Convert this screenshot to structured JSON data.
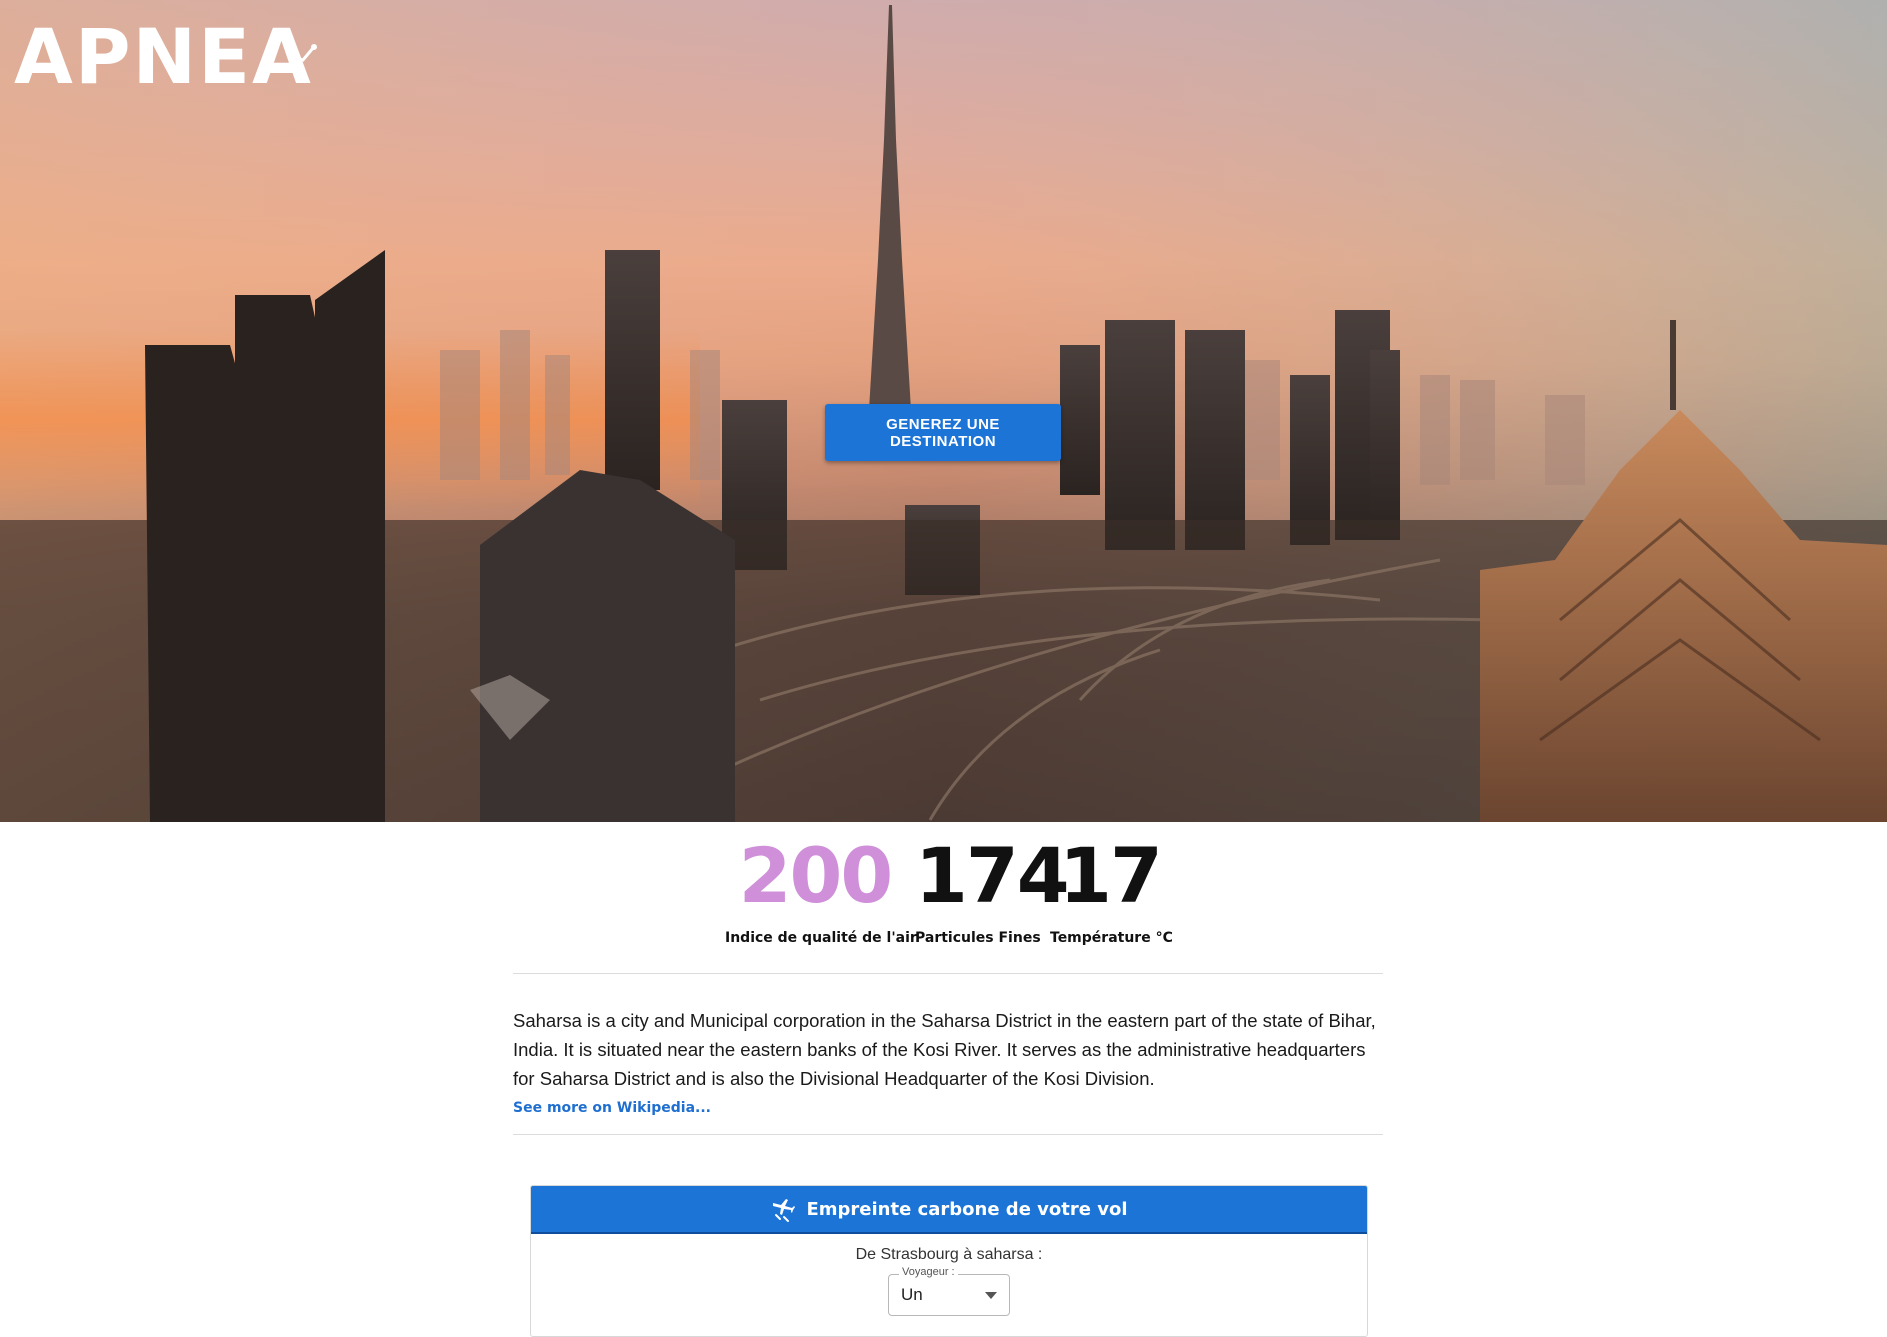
{
  "brand": {
    "logo_text": "APNEA"
  },
  "hero": {
    "cta_label": "GENEREZ UNE DESTINATION"
  },
  "stats": {
    "aqi": {
      "value": "200",
      "label": "Indice de qualité de l'air",
      "color": "#cf8fd9"
    },
    "pm": {
      "value": "174",
      "label": "Particules Fines"
    },
    "temperature": {
      "value": "17",
      "label": "Température °C"
    }
  },
  "description": {
    "text": "Saharsa is a city and Municipal corporation in the Saharsa District in the eastern part of the state of Bihar, India. It is situated near the eastern banks of the Kosi River. It serves as the administrative headquarters for Saharsa District and is also the Divisional Headquarter of the Kosi Division.",
    "wiki_link": "See more on Wikipedia..."
  },
  "carbon": {
    "title": "Empreinte carbone de votre vol",
    "route": "De Strasbourg à saharsa :",
    "traveler_label": "Voyageur :",
    "traveler_value": "Un"
  },
  "icons": {
    "logo": "diver-icon",
    "card": "plane-carbon-icon",
    "select": "caret-down-icon"
  },
  "colors": {
    "primary": "#1c74d6",
    "link": "#1f6fd0",
    "aqi": "#cf8fd9"
  }
}
